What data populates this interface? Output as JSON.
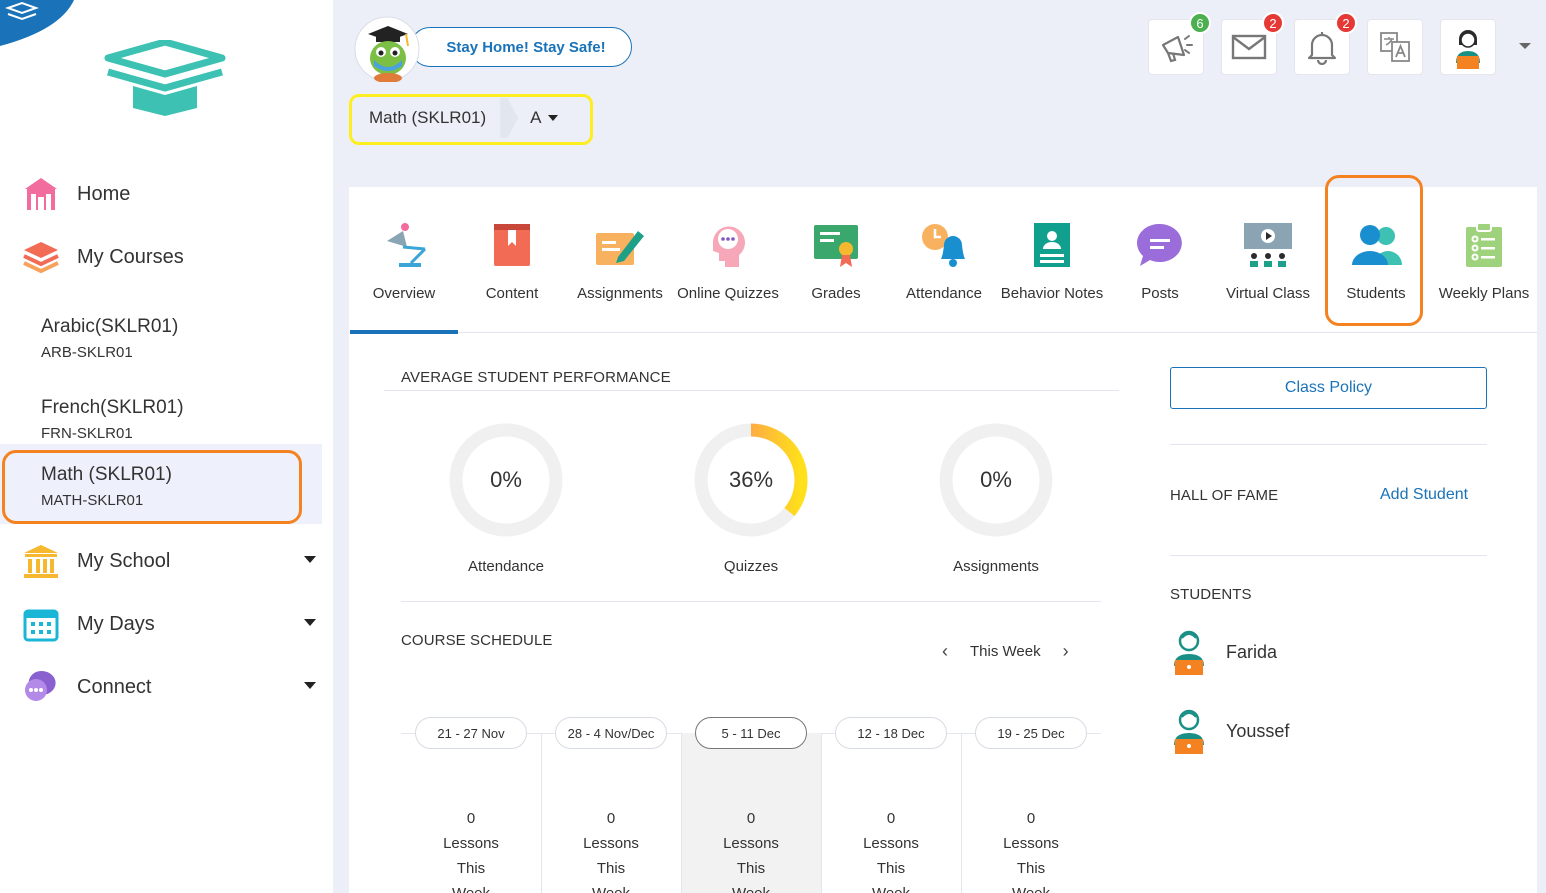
{
  "sidebar": {
    "nav": {
      "home": "Home",
      "my_courses": "My Courses",
      "my_school": "My School",
      "my_days": "My Days",
      "connect": "Connect"
    },
    "courses": [
      {
        "name": "Arabic(SKLR01)",
        "code": "ARB-SKLR01"
      },
      {
        "name": "French(SKLR01)",
        "code": "FRN-SKLR01"
      },
      {
        "name": "Math (SKLR01)",
        "code": "MATH-SKLR01"
      }
    ]
  },
  "header": {
    "banner": "Stay Home! Stay Safe!",
    "course_selector": "Math (SKLR01)",
    "section_selector": "A",
    "badges": {
      "announcements": "6",
      "messages": "2",
      "notifications": "2"
    }
  },
  "tabs": [
    "Overview",
    "Content",
    "Assignments",
    "Online Quizzes",
    "Grades",
    "Attendance",
    "Behavior Notes",
    "Posts",
    "Virtual Class",
    "Students",
    "Weekly Plans"
  ],
  "performance": {
    "title": "AVERAGE STUDENT PERFORMANCE",
    "metrics": [
      {
        "label": "Attendance",
        "display": "0%",
        "value": 0
      },
      {
        "label": "Quizzes",
        "display": "36%",
        "value": 36
      },
      {
        "label": "Assignments",
        "display": "0%",
        "value": 0
      }
    ]
  },
  "schedule": {
    "title": "COURSE SCHEDULE",
    "week_label": "This Week",
    "weeks": [
      {
        "range": "21 - 27 Nov",
        "count": "0"
      },
      {
        "range": "28 - 4 Nov/Dec",
        "count": "0"
      },
      {
        "range": "5 - 11 Dec",
        "count": "0"
      },
      {
        "range": "12 - 18 Dec",
        "count": "0"
      },
      {
        "range": "19 - 25 Dec",
        "count": "0"
      }
    ],
    "count_lines": [
      "Lessons",
      "This",
      "Week"
    ]
  },
  "right_panel": {
    "class_policy": "Class Policy",
    "hall_of_fame": "HALL OF FAME",
    "add_student": "Add Student",
    "students_title": "STUDENTS",
    "students": [
      "Farida",
      "Youssef"
    ]
  },
  "colors": {
    "accent": "#1a73b8",
    "highlight_orange": "#f58220",
    "highlight_yellow": "#fdee21",
    "badge_green": "#4caf50",
    "badge_red": "#e53935"
  }
}
